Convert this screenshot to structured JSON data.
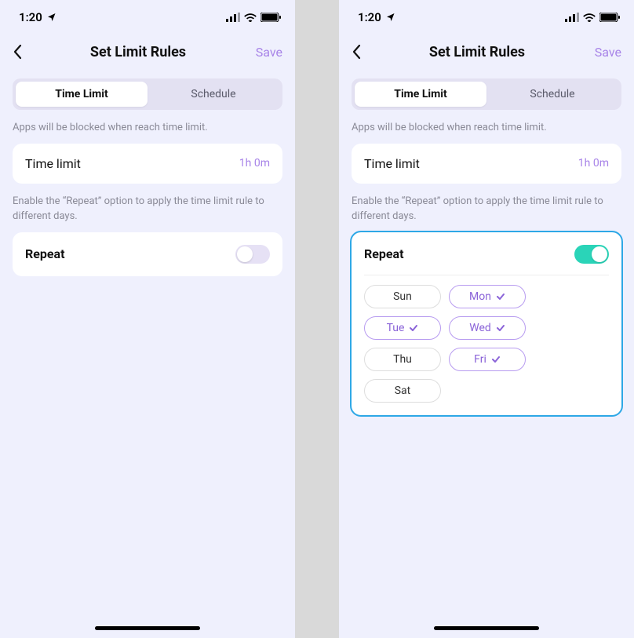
{
  "status": {
    "time": "1:20"
  },
  "nav": {
    "title": "Set Limit Rules",
    "save": "Save"
  },
  "tabs": {
    "timeLimit": "Time Limit",
    "schedule": "Schedule"
  },
  "hint1": "Apps will be blocked when reach time limit.",
  "timeLimit": {
    "label": "Time limit",
    "value": "1h 0m"
  },
  "hint2": "Enable the “Repeat” option to apply the time limit rule to different days.",
  "repeat": {
    "label": "Repeat"
  },
  "days": [
    "Sun",
    "Mon",
    "Tue",
    "Wed",
    "Thu",
    "Fri",
    "Sat"
  ],
  "left": {
    "repeatOn": false
  },
  "right": {
    "repeatOn": true,
    "selectedDays": [
      "Mon",
      "Tue",
      "Wed",
      "Fri"
    ]
  }
}
